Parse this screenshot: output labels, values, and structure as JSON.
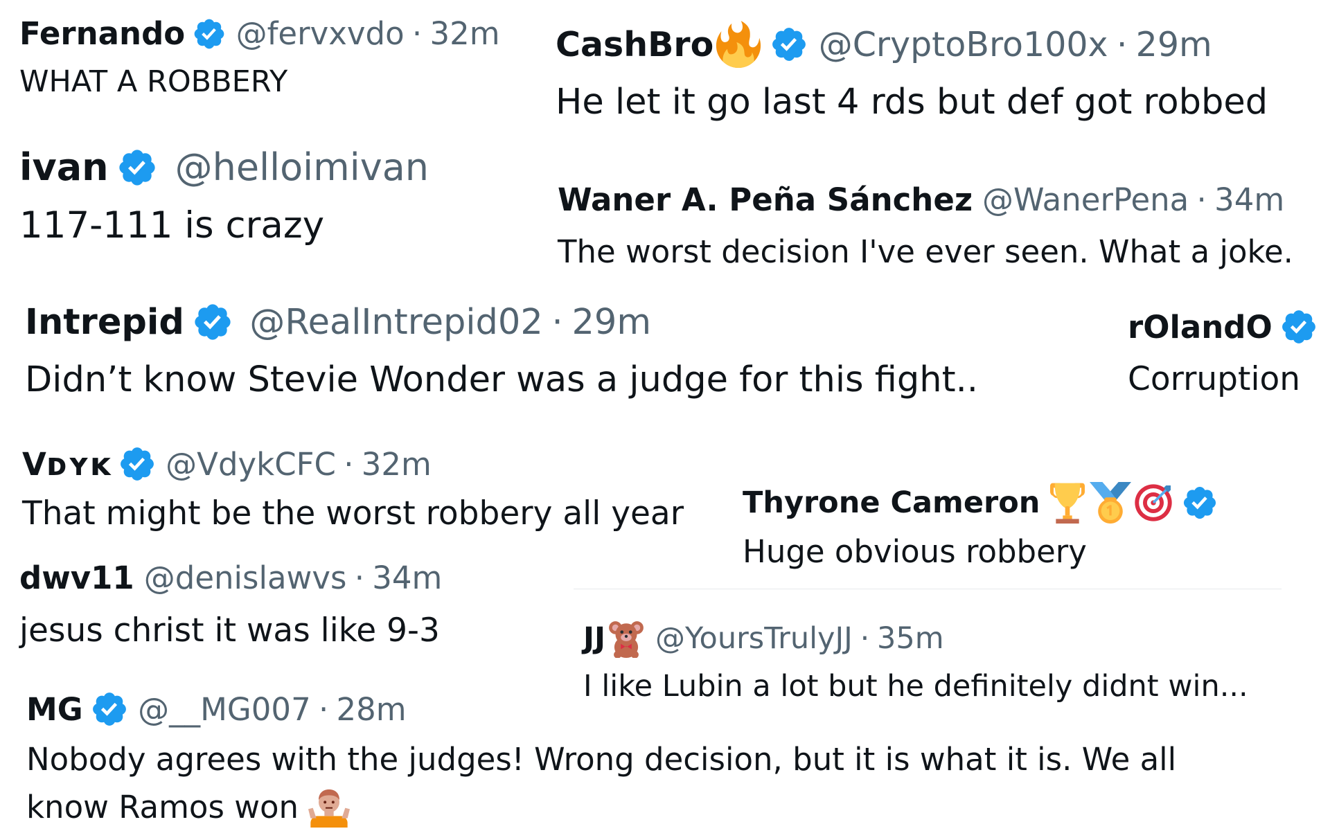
{
  "colors": {
    "verified": "#1d9bf0",
    "name": "#0f1419",
    "meta": "#536471",
    "divider": "#e6e9ec"
  },
  "tweets": [
    {
      "name": "Fernando",
      "handle": "@fervxvdo",
      "time": "32m",
      "text": "WHAT A ROBBERY",
      "verified": true
    },
    {
      "name": "CashBro",
      "handle": "@CryptoBro100x",
      "time": "29m",
      "text": "He let it go last 4 rds but def got robbed",
      "verified": true,
      "emojis": [
        "fire-emoji"
      ]
    },
    {
      "name": "ivan",
      "handle": "@helloimivan",
      "time": "",
      "text": "117-111 is crazy",
      "verified": true
    },
    {
      "name": "Waner A. Peña Sánchez",
      "handle": "@WanerPena",
      "time": "34m",
      "text": "The worst decision I've ever seen. What a joke.",
      "verified": false
    },
    {
      "name": "Intrepid",
      "handle": "@RealIntrepid02",
      "time": "29m",
      "text": "Didn’t know Stevie Wonder was a judge for this fight..",
      "verified": true
    },
    {
      "name": "rOlandO",
      "handle": "",
      "time": "",
      "text": "Corruption",
      "verified": true
    },
    {
      "name": "Vᴅʏᴋ",
      "handle": "@VdykCFC",
      "time": "32m",
      "text": "That might be the worst robbery all year",
      "verified": true
    },
    {
      "name": "Thyrone Cameron",
      "handle": "",
      "time": "",
      "text": "Huge obvious robbery",
      "verified": true,
      "emojis": [
        "trophy-emoji",
        "medal-emoji",
        "target-emoji"
      ]
    },
    {
      "name": "dwv11",
      "handle": "@denislawvs",
      "time": "34m",
      "text": "jesus christ it was like 9-3",
      "verified": false
    },
    {
      "name": "JJ",
      "handle": "@YoursTrulyJJ",
      "time": "35m",
      "text": "I like Lubin a lot but he definitely didnt win...",
      "verified": false,
      "emojis": [
        "teddy-bear-emoji"
      ]
    },
    {
      "name": "MG",
      "handle": "@__MG007",
      "time": "28m",
      "text_line1": "Nobody agrees with the judges! Wrong decision, but it is what it is. We all",
      "text_line2": "know Ramos won",
      "verified": true,
      "emojis": [
        "shrug-emoji"
      ]
    }
  ]
}
